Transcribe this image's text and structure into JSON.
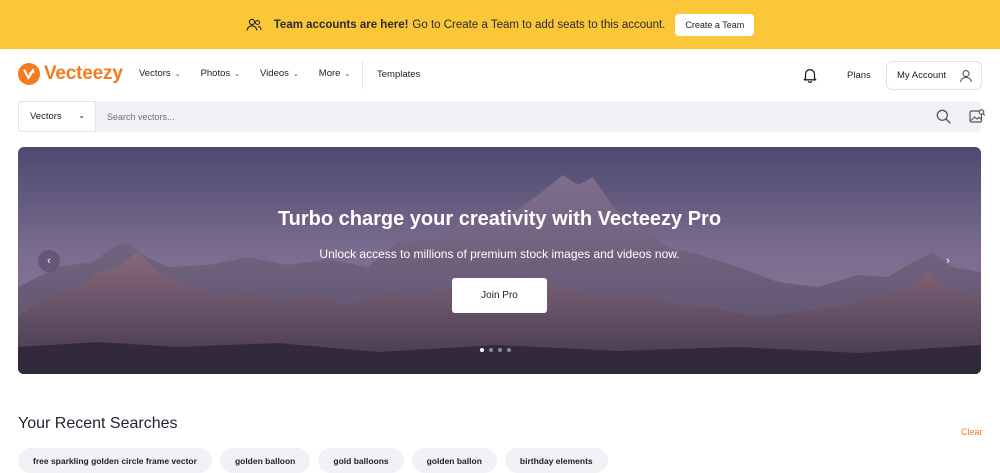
{
  "banner": {
    "icon": "team-icon",
    "strong_text": "Team accounts are here!",
    "text": "Go to Create a Team to add seats to this account.",
    "button_label": "Create a Team",
    "background_color": "#fbc739"
  },
  "nav": {
    "logo_text": "Vecteezy",
    "brand_color": "#f47b20",
    "items": [
      {
        "label": "Vectors"
      },
      {
        "label": "Photos"
      },
      {
        "label": "Videos"
      },
      {
        "label": "More"
      }
    ],
    "templates_label": "Templates",
    "notification_icon": "bell-icon",
    "plans_label": "Plans",
    "account_label": "My Account",
    "account_icon": "user-icon"
  },
  "search": {
    "category_value": "Vectors",
    "placeholder": "Search vectors...",
    "search_icon": "search-icon",
    "image_search_icon": "image-search-icon"
  },
  "hero": {
    "title": "Turbo charge your creativity with Vecteezy Pro",
    "subtitle": "Unlock access to millions of premium stock images and videos now.",
    "button_label": "Join Pro",
    "slide_count": 4,
    "active_slide": 1
  },
  "recent": {
    "title": "Your Recent Searches",
    "clear_label": "Clear",
    "searches": [
      "free sparkling golden circle frame vector",
      "golden balloon",
      "gold balloons",
      "golden ballon",
      "birthday elements"
    ]
  }
}
